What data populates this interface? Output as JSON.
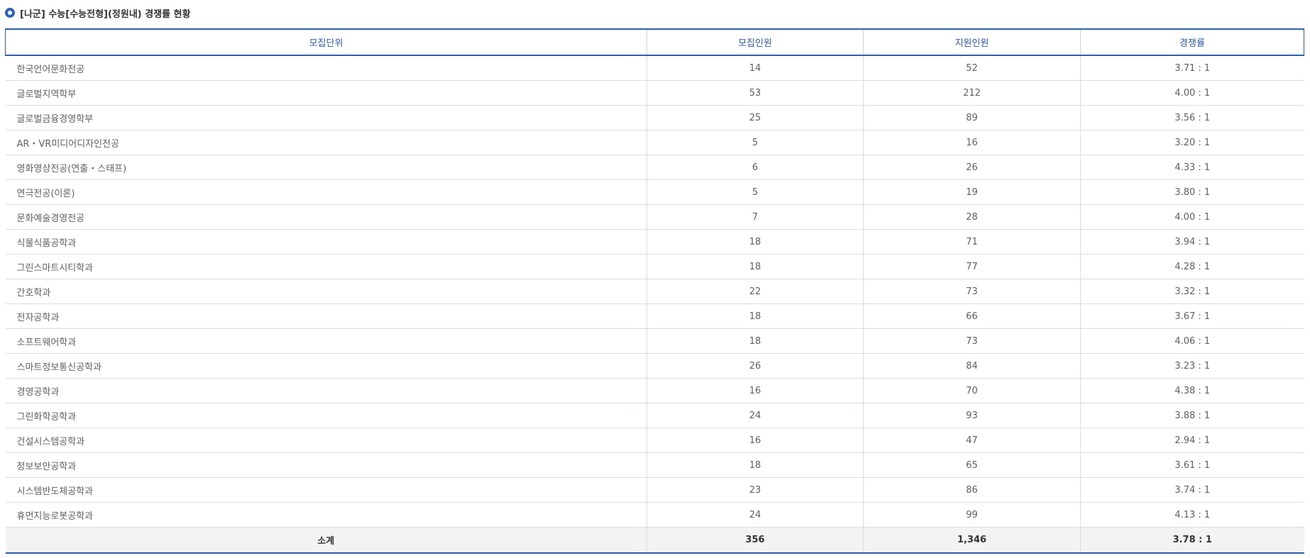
{
  "title": "[나군] 수능[수능전형](정원내) 경쟁률 현황",
  "headers": {
    "unit": "모집단위",
    "quota": "모집인원",
    "applicants": "지원인원",
    "ratio": "경쟁률"
  },
  "rows": [
    {
      "unit": "한국언어문화전공",
      "quota": "14",
      "applicants": "52",
      "ratio": "3.71 : 1"
    },
    {
      "unit": "글로벌지역학부",
      "quota": "53",
      "applicants": "212",
      "ratio": "4.00 : 1"
    },
    {
      "unit": "글로벌금융경영학부",
      "quota": "25",
      "applicants": "89",
      "ratio": "3.56 : 1"
    },
    {
      "unit": "AR・VR미디어디자인전공",
      "quota": "5",
      "applicants": "16",
      "ratio": "3.20 : 1"
    },
    {
      "unit": "영화영상전공(연출・스태프)",
      "quota": "6",
      "applicants": "26",
      "ratio": "4.33 : 1"
    },
    {
      "unit": "연극전공(이론)",
      "quota": "5",
      "applicants": "19",
      "ratio": "3.80 : 1"
    },
    {
      "unit": "문화예술경영전공",
      "quota": "7",
      "applicants": "28",
      "ratio": "4.00 : 1"
    },
    {
      "unit": "식물식품공학과",
      "quota": "18",
      "applicants": "71",
      "ratio": "3.94 : 1"
    },
    {
      "unit": "그린스마트시티학과",
      "quota": "18",
      "applicants": "77",
      "ratio": "4.28 : 1"
    },
    {
      "unit": "간호학과",
      "quota": "22",
      "applicants": "73",
      "ratio": "3.32 : 1"
    },
    {
      "unit": "전자공학과",
      "quota": "18",
      "applicants": "66",
      "ratio": "3.67 : 1"
    },
    {
      "unit": "소프트웨어학과",
      "quota": "18",
      "applicants": "73",
      "ratio": "4.06 : 1"
    },
    {
      "unit": "스마트정보통신공학과",
      "quota": "26",
      "applicants": "84",
      "ratio": "3.23 : 1"
    },
    {
      "unit": "경영공학과",
      "quota": "16",
      "applicants": "70",
      "ratio": "4.38 : 1"
    },
    {
      "unit": "그린화학공학과",
      "quota": "24",
      "applicants": "93",
      "ratio": "3.88 : 1"
    },
    {
      "unit": "건설시스템공학과",
      "quota": "16",
      "applicants": "47",
      "ratio": "2.94 : 1"
    },
    {
      "unit": "정보보안공학과",
      "quota": "18",
      "applicants": "65",
      "ratio": "3.61 : 1"
    },
    {
      "unit": "시스템반도체공학과",
      "quota": "23",
      "applicants": "86",
      "ratio": "3.74 : 1"
    },
    {
      "unit": "휴먼지능로봇공학과",
      "quota": "24",
      "applicants": "99",
      "ratio": "4.13 : 1"
    }
  ],
  "total": {
    "unit": "소계",
    "quota": "356",
    "applicants": "1,346",
    "ratio": "3.78 : 1"
  },
  "colors": {
    "accent": "#2f5fa8",
    "header_text": "#2d5ba5",
    "footer_bg": "#f3f3f3"
  },
  "icons": {
    "title_bullet": "radio-bullet-icon"
  }
}
